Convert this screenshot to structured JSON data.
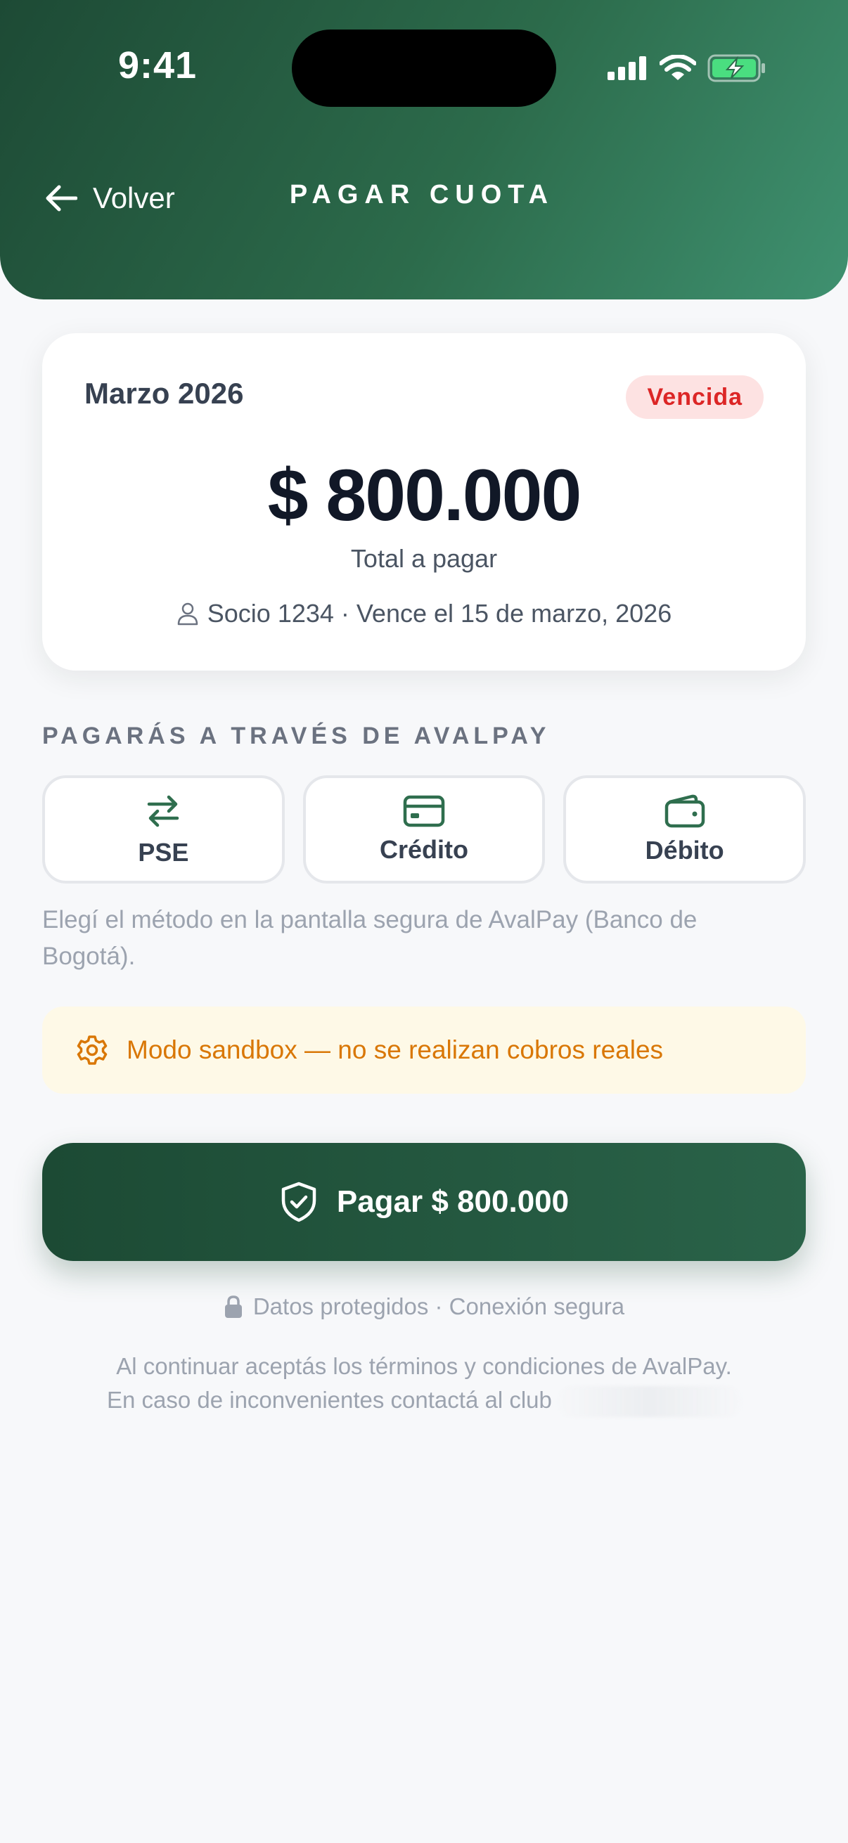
{
  "status_bar": {
    "time": "9:41"
  },
  "header": {
    "back_label": "Volver",
    "title": "PAGAR CUOTA"
  },
  "summary": {
    "period": "Marzo 2026",
    "status_badge": "Vencida",
    "amount": "$ 800.000",
    "amount_label": "Total a pagar",
    "meta": "Socio 1234 · Vence el 15 de marzo, 2026"
  },
  "payment": {
    "section_label": "PAGARÁS A TRAVÉS DE AVALPAY",
    "methods": [
      {
        "label": "PSE",
        "icon": "arrows-exchange-icon"
      },
      {
        "label": "Crédito",
        "icon": "credit-card-icon"
      },
      {
        "label": "Débito",
        "icon": "wallet-icon"
      }
    ],
    "helper": "Elegí el método en la pantalla segura de AvalPay (Banco de Bogotá)."
  },
  "sandbox_notice": "Modo sandbox — no se realizan cobros reales",
  "pay_button": "Pagar $ 800.000",
  "security_note": "Datos protegidos · Conexión segura",
  "terms": {
    "line1": "Al continuar aceptás los términos y condiciones de AvalPay.",
    "line2": "En caso de inconvenientes contactá al club"
  },
  "colors": {
    "brand_dark": "#1d4a35",
    "brand_light": "#3f9170",
    "danger": "#dc2626",
    "warning": "#d97706",
    "background": "#f7f8fa"
  }
}
